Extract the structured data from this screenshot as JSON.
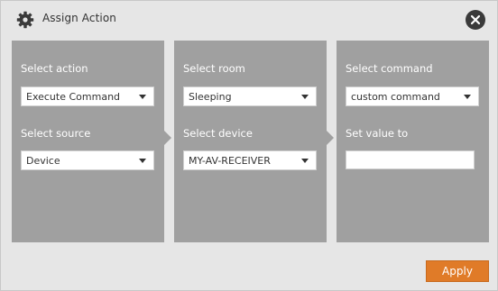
{
  "dialog": {
    "title": "Assign Action",
    "title_icon": "gear-icon",
    "close_icon": "close-icon"
  },
  "panels": {
    "action": {
      "action_label": "Select action",
      "action_value": "Execute Command",
      "source_label": "Select source",
      "source_value": "Device"
    },
    "room": {
      "room_label": "Select room",
      "room_value": "Sleeping",
      "device_label": "Select device",
      "device_value": "MY-AV-RECEIVER"
    },
    "command": {
      "command_label": "Select command",
      "command_value": "custom command",
      "value_label": "Set value to",
      "value_input": ""
    }
  },
  "footer": {
    "apply_label": "Apply"
  },
  "colors": {
    "background": "#e6e6e6",
    "panel": "#a0a0a0",
    "accent": "#e07b28"
  }
}
